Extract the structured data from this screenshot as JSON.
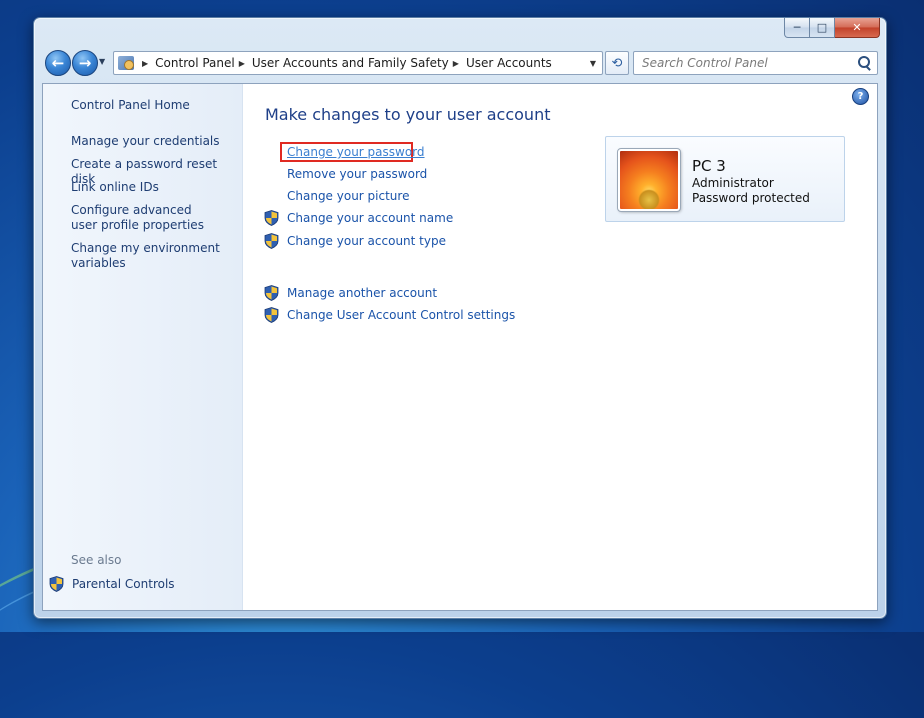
{
  "window": {
    "caption": {
      "min_glyph": "─",
      "max_glyph": "□",
      "close_glyph": "✕"
    }
  },
  "navigation": {
    "back_glyph": "←",
    "forward_glyph": "→",
    "recent_glyph": "▼",
    "breadcrumb": [
      "Control Panel",
      "User Accounts and Family Safety",
      "User Accounts"
    ],
    "separator_glyph": "▶",
    "dropdown_glyph": "▼",
    "refresh_glyph": "⟲",
    "search_placeholder": "Search Control Panel"
  },
  "sidebar": {
    "home": "Control Panel Home",
    "tasks": [
      "Manage your credentials",
      "Create a password reset disk",
      "Link online IDs",
      "Configure advanced user profile properties",
      "Change my environment variables"
    ],
    "see_also_heading": "See also",
    "see_also_items": [
      "Parental Controls"
    ]
  },
  "main": {
    "title": "Make changes to your user account",
    "help_glyph": "?",
    "links": [
      {
        "label": "Change your password",
        "shield": false,
        "highlighted": true
      },
      {
        "label": "Remove your password",
        "shield": false
      },
      {
        "label": "Change your picture",
        "shield": false
      },
      {
        "label": "Change your account name",
        "shield": true
      },
      {
        "label": "Change your account type",
        "shield": true
      }
    ],
    "other_links": [
      {
        "label": "Manage another account",
        "shield": true
      },
      {
        "label": "Change User Account Control settings",
        "shield": true
      }
    ]
  },
  "account": {
    "name": "PC 3",
    "type": "Administrator",
    "status": "Password protected"
  },
  "colors": {
    "link": "#1a53a9",
    "title": "#1e3f88",
    "highlight_border": "#e02a22"
  }
}
